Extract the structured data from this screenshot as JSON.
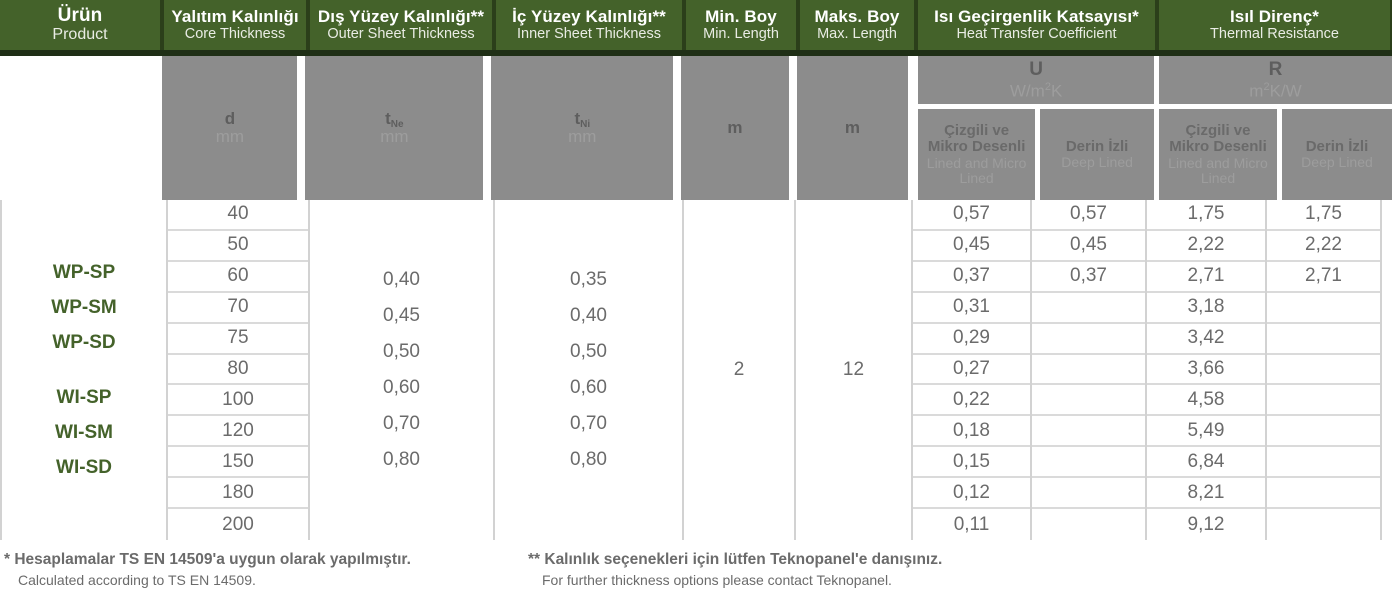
{
  "header": {
    "columns": [
      {
        "tr": "Ürün",
        "en": "Product",
        "big": true
      },
      {
        "tr": "Yalıtım Kalınlığı",
        "en": "Core Thickness",
        "big": false
      },
      {
        "tr": "Dış Yüzey Kalınlığı**",
        "en": "Outer Sheet Thickness",
        "big": false
      },
      {
        "tr": "İç Yüzey Kalınlığı**",
        "en": "Inner Sheet Thickness",
        "big": false
      },
      {
        "tr": "Min. Boy",
        "en": "Min. Length",
        "big": false
      },
      {
        "tr": "Maks. Boy",
        "en": "Maks. Length",
        "big": false
      },
      {
        "tr": "Isı Geçirgenlik Katsayısı*",
        "en": "Heat Transfer Coefficient",
        "big": false
      },
      {
        "tr": "Isıl Direnç*",
        "en": "Thermal Resistance",
        "big": false
      }
    ],
    "max_length_en": "Max. Length"
  },
  "subheader": {
    "core_symbol": "d",
    "core_unit": "mm",
    "outer_symbol": "t",
    "outer_subscript": "Ne",
    "outer_unit": "mm",
    "inner_symbol": "t",
    "inner_subscript": "Ni",
    "inner_unit": "mm",
    "min_length_unit": "m",
    "max_length_unit": "m",
    "u_symbol": "U",
    "u_unit_pre": "W/m",
    "u_unit_sup": "2",
    "u_unit_post": "K",
    "r_symbol": "R",
    "r_unit_pre": "m",
    "r_unit_sup": "2",
    "r_unit_post": "K/W",
    "lined_tr_1": "Çizgili ve",
    "lined_tr_2": "Mikro Desenli",
    "lined_en_1": "Lined and Micro",
    "lined_en_2": "Lined",
    "deep_tr": "Derin İzli",
    "deep_en": "Deep Lined"
  },
  "body": {
    "products_group_1": [
      "WP-SP",
      "WP-SM",
      "WP-SD"
    ],
    "products_group_2": [
      "WI-SP",
      "WI-SM",
      "WI-SD"
    ],
    "core_thickness": [
      "40",
      "50",
      "60",
      "70",
      "75",
      "80",
      "100",
      "120",
      "150",
      "180",
      "200"
    ],
    "outer_sheet_thickness": [
      "0,40",
      "0,45",
      "0,50",
      "0,60",
      "0,70",
      "0,80"
    ],
    "inner_sheet_thickness": [
      "0,35",
      "0,40",
      "0,50",
      "0,60",
      "0,70",
      "0,80"
    ],
    "min_length": "2",
    "max_length": "12",
    "u_lined_micro": [
      "0,57",
      "0,45",
      "0,37",
      "0,31",
      "0,29",
      "0,27",
      "0,22",
      "0,18",
      "0,15",
      "0,12",
      "0,11"
    ],
    "u_deep_lined": [
      "0,57",
      "0,45",
      "0,37",
      "",
      "",
      "",
      "",
      "",
      "",
      "",
      ""
    ],
    "r_lined_micro": [
      "1,75",
      "2,22",
      "2,71",
      "3,18",
      "3,42",
      "3,66",
      "4,58",
      "5,49",
      "6,84",
      "8,21",
      "9,12"
    ],
    "r_deep_lined": [
      "1,75",
      "2,22",
      "2,71",
      "",
      "",
      "",
      "",
      "",
      "",
      "",
      ""
    ]
  },
  "footnotes": {
    "note1_tr": "* Hesaplamalar TS EN 14509'a uygun olarak yapılmıştır.",
    "note1_en": "Calculated according to TS EN 14509.",
    "note2_tr": "** Kalınlık seçenekleri için lütfen Teknopanel'e danışınız.",
    "note2_en": "For further thickness options please contact Teknopanel."
  },
  "colors": {
    "header_green": "#44622a",
    "header_dark_green": "#1f2f16",
    "product_green": "#44622a",
    "subheader_gray": "#8c8c8c",
    "body_text_gray": "#6b6b6b"
  }
}
